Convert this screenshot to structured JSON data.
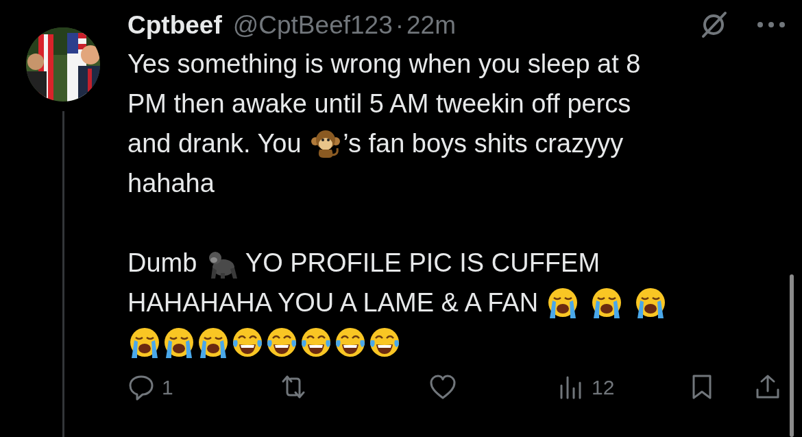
{
  "post": {
    "display_name": "Cptbeef",
    "handle": "@CptBeef123",
    "separator": "·",
    "time": "22m",
    "paragraphs": [
      {
        "lines": [
          [
            {
              "kind": "text",
              "text": "Yes something is wrong when you sleep at 8"
            }
          ],
          [
            {
              "kind": "text",
              "text": "PM then awake until 5 AM tweekin off percs"
            }
          ],
          [
            {
              "kind": "text",
              "text": "and drank. You "
            },
            {
              "kind": "monkey"
            },
            {
              "kind": "text",
              "text": "’s fan boys shits crazyyy"
            }
          ],
          [
            {
              "kind": "text",
              "text": "hahaha"
            }
          ]
        ]
      },
      {
        "lines": [
          [
            {
              "kind": "text",
              "text": "Dumb "
            },
            {
              "kind": "gorilla"
            },
            {
              "kind": "text",
              "text": " YO PROFILE PIC IS CUFFEM"
            }
          ],
          [
            {
              "kind": "text",
              "text": "HAHAHAHA YOU A LAME & A FAN "
            },
            {
              "kind": "crying"
            },
            {
              "kind": "space"
            },
            {
              "kind": "crying"
            },
            {
              "kind": "space"
            },
            {
              "kind": "crying"
            }
          ],
          [
            {
              "kind": "crying"
            },
            {
              "kind": "crying"
            },
            {
              "kind": "crying"
            },
            {
              "kind": "laughing"
            },
            {
              "kind": "laughing"
            },
            {
              "kind": "laughing"
            },
            {
              "kind": "laughing"
            },
            {
              "kind": "laughing"
            }
          ]
        ]
      }
    ],
    "actions": [
      {
        "kind": "reply",
        "count": "1"
      },
      {
        "kind": "repost"
      },
      {
        "kind": "like"
      },
      {
        "kind": "views",
        "count": "12"
      },
      {
        "kind": "bookmark"
      },
      {
        "kind": "share"
      }
    ]
  }
}
